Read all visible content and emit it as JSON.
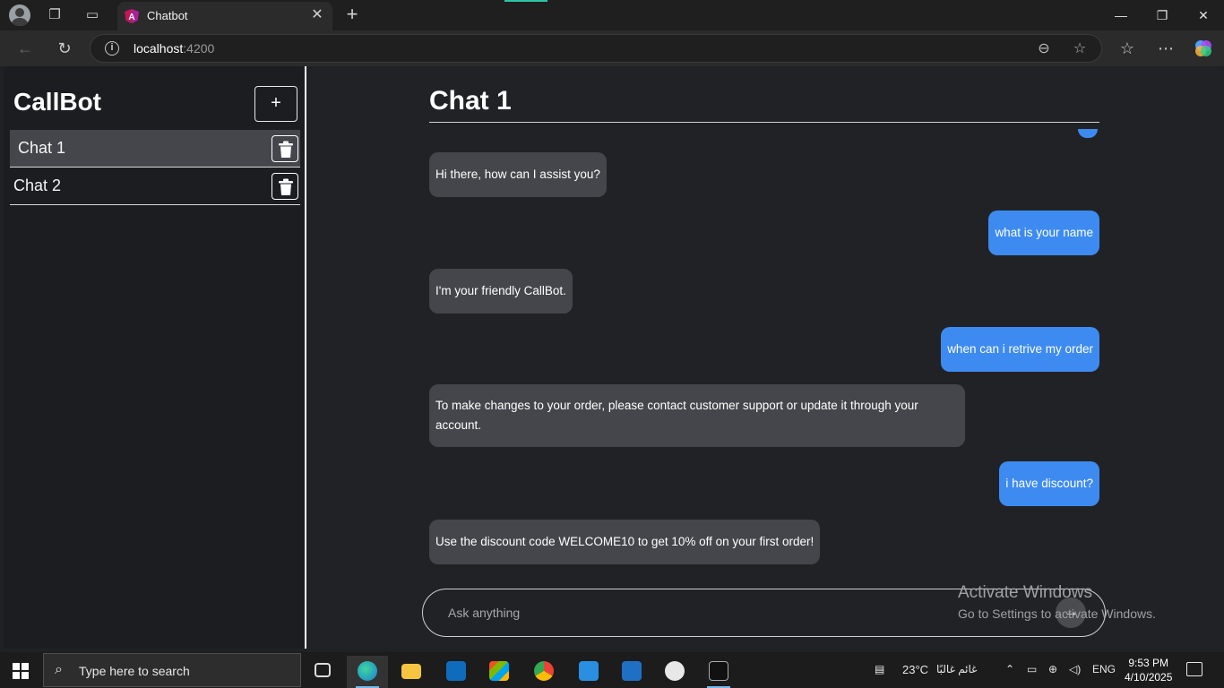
{
  "browser": {
    "tab_title": "Chatbot",
    "url_host": "localhost",
    "url_port": ":4200"
  },
  "sidebar": {
    "brand": "CallBot",
    "add_label": "+",
    "chats": [
      {
        "label": "Chat 1",
        "active": true
      },
      {
        "label": "Chat 2",
        "active": false
      }
    ]
  },
  "chat": {
    "title": "Chat 1",
    "messages": [
      {
        "role": "bot",
        "text": "Hi there, how can I assist you?"
      },
      {
        "role": "user",
        "text": "what is your name"
      },
      {
        "role": "bot",
        "text": "I'm your friendly CallBot."
      },
      {
        "role": "user",
        "text": "when can i retrive my order"
      },
      {
        "role": "bot",
        "text": "To make changes to your order, please contact customer support or update it through your account."
      },
      {
        "role": "user",
        "text": "i have discount?"
      },
      {
        "role": "bot",
        "text": "Use the discount code WELCOME10 to get 10% off on your first order!"
      }
    ],
    "input_placeholder": "Ask anything",
    "send_icon": "arrow-right-icon"
  },
  "activation": {
    "line1": "Activate Windows",
    "line2": "Go to Settings to activate Windows."
  },
  "taskbar": {
    "search_placeholder": "Type here to search",
    "weather": "23°C",
    "weather_desc": "غائم غالبًا",
    "language": "ENG",
    "time": "9:53 PM",
    "date": "4/10/2025"
  },
  "colors": {
    "user_bubble": "#3d8bf0",
    "bot_bubble": "#45464b",
    "background": "#212226"
  }
}
